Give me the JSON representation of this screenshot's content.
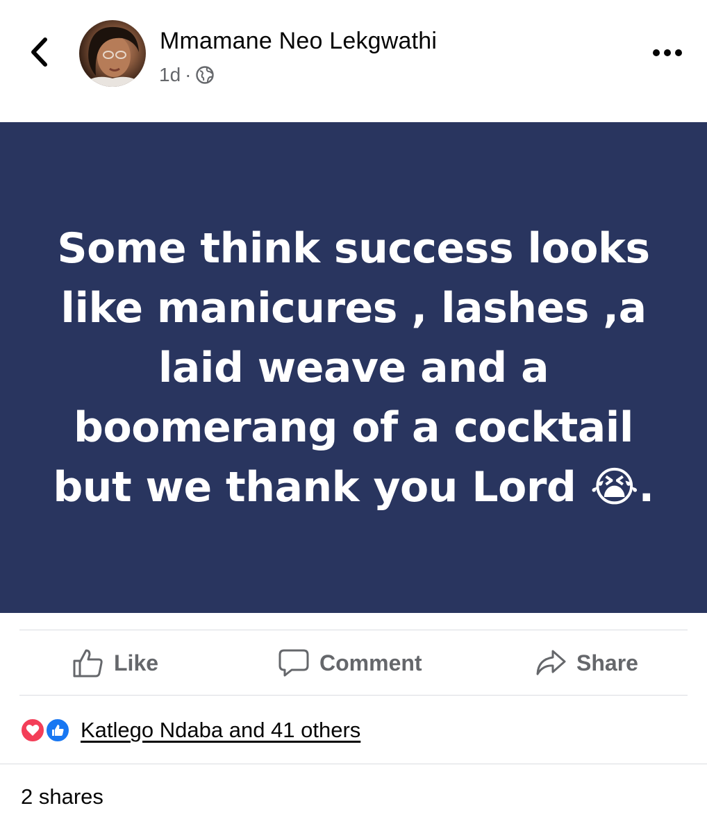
{
  "post": {
    "author": "Mmamane Neo Lekgwathi",
    "time": "1d",
    "separator": "·",
    "privacy_icon": "globe-icon",
    "text": "Some think success looks like manicures , lashes ,a laid weave and a boomerang of a cocktail but we thank you Lord 😭.",
    "background_color": "#29355f"
  },
  "actions": {
    "like_label": "Like",
    "comment_label": "Comment",
    "share_label": "Share"
  },
  "reactions": {
    "icons": [
      "love-reaction-icon",
      "like-reaction-icon"
    ],
    "summary": "Katlego Ndaba and 41 others"
  },
  "shares": "2 shares",
  "colors": {
    "secondary_text": "#65676b",
    "love": "#f33e58",
    "like": "#1877f2"
  }
}
